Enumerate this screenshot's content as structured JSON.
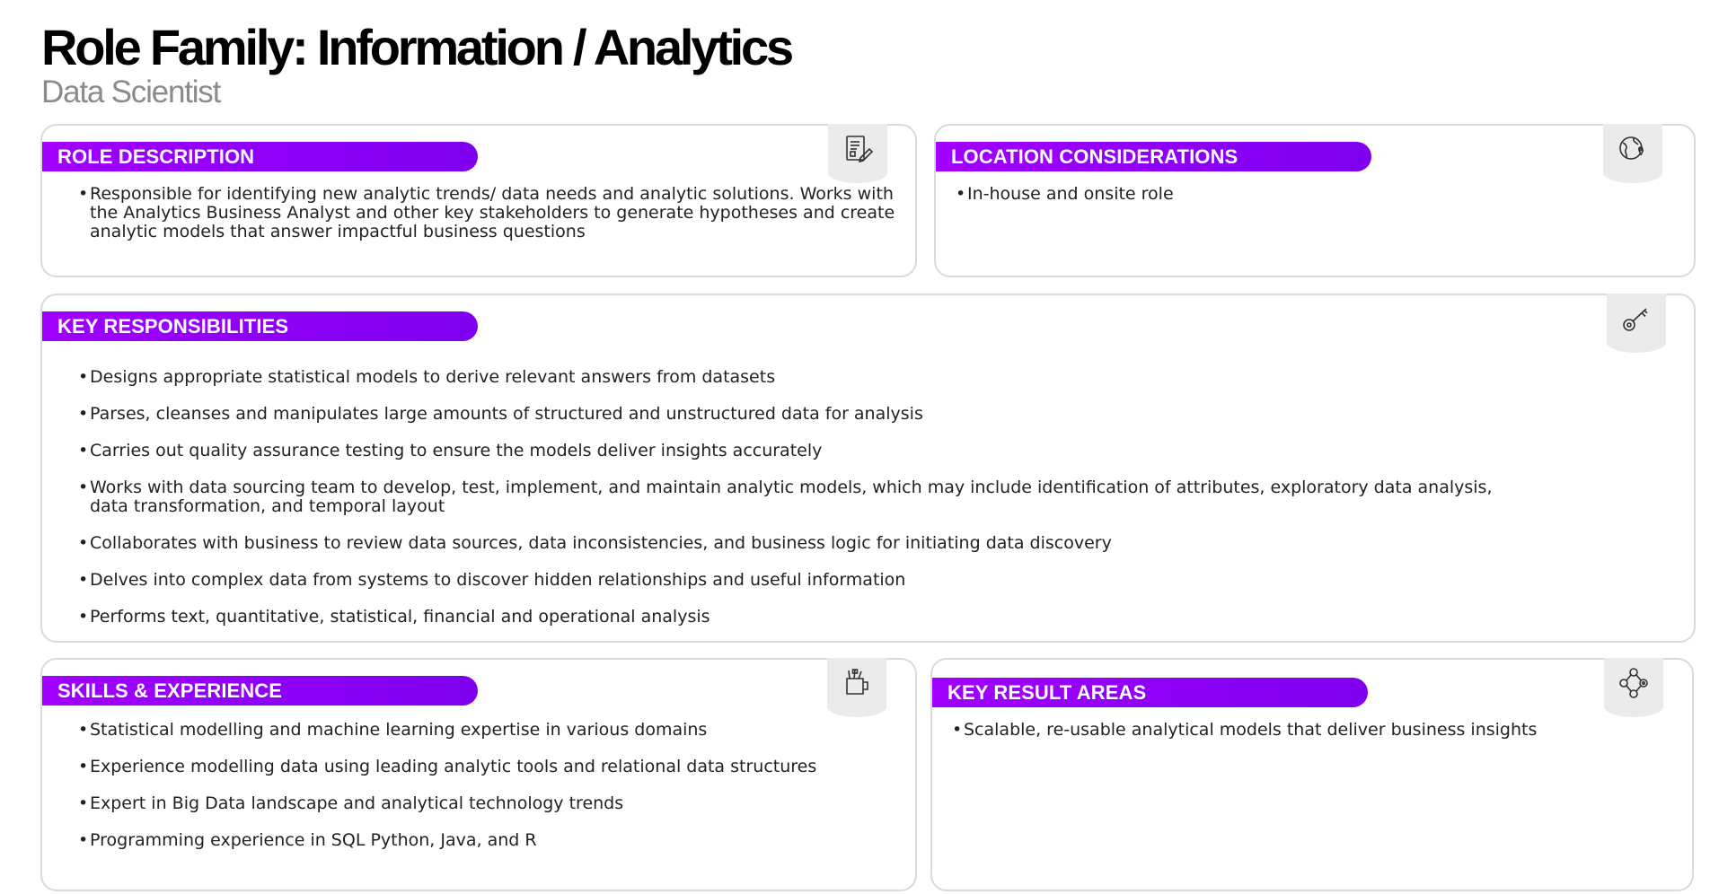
{
  "header": {
    "title": "Role Family: Information / Analytics",
    "subtitle": "Data Scientist"
  },
  "colors": {
    "accent": "#a100ff",
    "border": "#d9d9d9",
    "subtitle": "#8b8b8b"
  },
  "sections": {
    "role_description": {
      "title": "ROLE DESCRIPTION",
      "icon": "document-edit-icon",
      "items": [
        "Responsible for identifying new analytic trends/ data needs and analytic solutions. Works with the Analytics Business Analyst and other key stakeholders to generate hypotheses and create analytic models that answer impactful business questions"
      ]
    },
    "location_considerations": {
      "title": "LOCATION CONSIDERATIONS",
      "icon": "globe-location-icon",
      "items": [
        "In-house and onsite role"
      ]
    },
    "key_responsibilities": {
      "title": "KEY RESPONSIBILITIES",
      "icon": "key-icon",
      "items": [
        "Designs appropriate statistical models to derive relevant answers from datasets",
        "Parses, cleanses and manipulates large amounts of structured and unstructured data for analysis",
        "Carries out quality assurance testing to ensure the models deliver insights accurately",
        "Works with data sourcing team to develop, test, implement, and maintain analytic models, which may include identification of attributes, exploratory data analysis, data transformation, and temporal layout",
        "Collaborates with business to review data sources, data inconsistencies, and business logic for initiating data discovery",
        "Delves into complex data from systems to discover hidden relationships and useful information",
        "Performs text, quantitative, statistical, financial and operational analysis"
      ]
    },
    "skills_experience": {
      "title": "SKILLS & EXPERIENCE",
      "icon": "toolbox-cup-icon",
      "items": [
        "Statistical modelling and machine learning expertise in various domains",
        "Experience modelling data using leading analytic tools and relational data structures",
        "Expert in Big Data landscape and analytical technology trends",
        "Programming experience in SQL Python, Java, and R"
      ]
    },
    "key_result_areas": {
      "title": "KEY RESULT AREAS",
      "icon": "network-nodes-icon",
      "items": [
        "Scalable, re-usable analytical models that deliver business insights"
      ]
    }
  }
}
